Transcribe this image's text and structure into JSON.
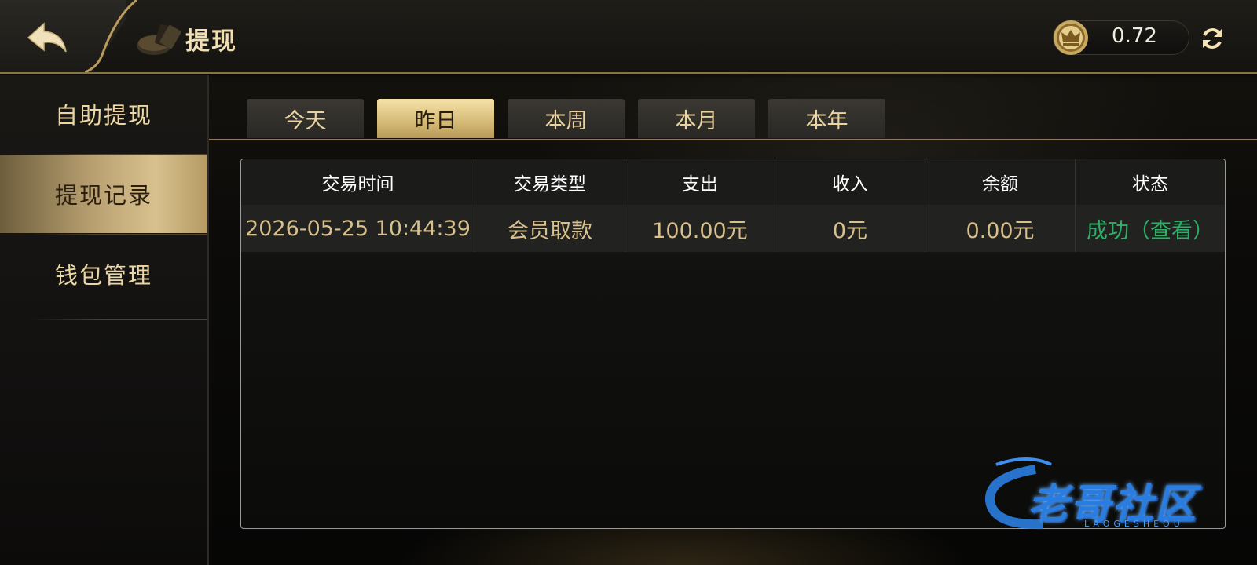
{
  "header": {
    "title": "提现",
    "balance": "0.72",
    "back_icon": "back-arrow-icon",
    "coin_icon": "crown-coin-icon",
    "refresh_icon": "refresh-icon"
  },
  "sidebar": {
    "items": [
      {
        "label": "自助提现",
        "active": false
      },
      {
        "label": "提现记录",
        "active": true
      },
      {
        "label": "钱包管理",
        "active": false
      }
    ]
  },
  "tabs": [
    {
      "label": "今天",
      "active": false
    },
    {
      "label": "昨日",
      "active": true
    },
    {
      "label": "本周",
      "active": false
    },
    {
      "label": "本月",
      "active": false
    },
    {
      "label": "本年",
      "active": false
    }
  ],
  "table": {
    "columns": [
      "交易时间",
      "交易类型",
      "支出",
      "收入",
      "余额",
      "状态"
    ],
    "rows": [
      [
        "2026-05-25 10:44:39",
        "会员取款",
        "100.00元",
        "0元",
        "0.00元",
        "成功（查看）"
      ]
    ]
  },
  "watermark": {
    "text": "老哥社区",
    "sub": "LAOGESHEQU"
  },
  "colors": {
    "gold": "#e9d4a1",
    "accent_gold": "#d8bd7a",
    "success_green": "#2fae68",
    "value_text": "#d8c08d"
  }
}
